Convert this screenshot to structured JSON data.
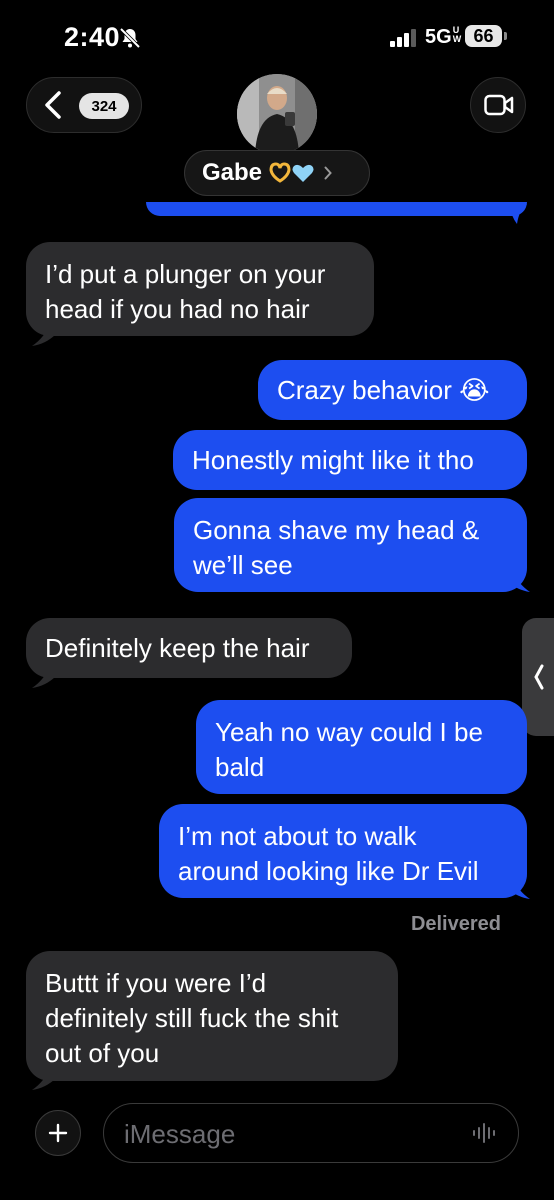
{
  "status_bar": {
    "time": "2:40",
    "network": "5G",
    "battery": "66"
  },
  "header": {
    "unread_count": "324",
    "contact_name": "Gabe"
  },
  "messages": [
    {
      "direction": "in",
      "text_lines": [
        "I’d put a plunger on your",
        "head if you had no hair"
      ]
    },
    {
      "direction": "out",
      "text_lines": [
        "Crazy behavior 😭"
      ]
    },
    {
      "direction": "out",
      "text_lines": [
        "Honestly might like it tho"
      ]
    },
    {
      "direction": "out",
      "text_lines": [
        "Gonna shave my head &",
        "we’ll see"
      ]
    },
    {
      "direction": "in",
      "text_lines": [
        "Definitely keep the hair"
      ]
    },
    {
      "direction": "out",
      "text_lines": [
        "Yeah no way could I be",
        "bald"
      ]
    },
    {
      "direction": "out",
      "text_lines": [
        "I’m not about to walk",
        "around looking like Dr Evil"
      ]
    },
    {
      "direction": "in",
      "text_lines": [
        "Buttt if you were I’d",
        "definitely still fuck the shit",
        "out of you"
      ]
    }
  ],
  "delivery_status": "Delivered",
  "composer": {
    "placeholder": "iMessage"
  },
  "icons": [
    "bell-slash-icon",
    "signal-icon",
    "back-chevron-icon",
    "video-camera-icon",
    "plus-icon",
    "audio-waveform-icon",
    "chevron-left-icon"
  ],
  "colors": {
    "outgoing_bubble": "#1d4ef0",
    "incoming_bubble": "#2c2c2e",
    "background": "#000000"
  }
}
